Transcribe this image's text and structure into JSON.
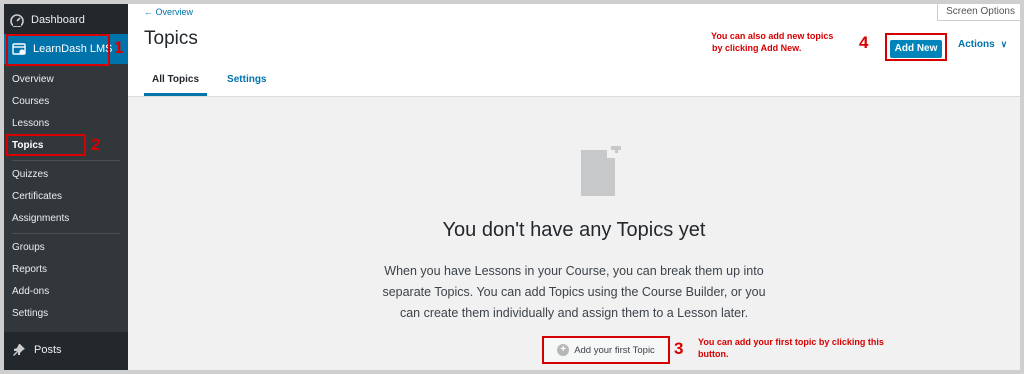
{
  "sidebar": {
    "dashboard_label": "Dashboard",
    "learndash_label": "LearnDash LMS",
    "items": [
      {
        "label": "Overview"
      },
      {
        "label": "Courses"
      },
      {
        "label": "Lessons"
      },
      {
        "label": "Topics"
      },
      {
        "label": "Quizzes"
      },
      {
        "label": "Certificates"
      },
      {
        "label": "Assignments"
      },
      {
        "label": "Groups"
      },
      {
        "label": "Reports"
      },
      {
        "label": "Add-ons"
      },
      {
        "label": "Settings"
      }
    ],
    "posts_label": "Posts"
  },
  "header": {
    "breadcrumb": "← Overview",
    "title": "Topics",
    "screen_options": "Screen Options",
    "add_new": "Add New",
    "actions": "Actions",
    "actions_chevron": "∨",
    "tabs": [
      {
        "label": "All Topics"
      },
      {
        "label": "Settings"
      }
    ]
  },
  "empty_state": {
    "heading": "You don't have any Topics yet",
    "body": "When you have Lessons in your Course, you can break them up into separate Topics. You can add Topics using the Course Builder, or you can create them individually and assign them to a Lesson later.",
    "button": "Add your first Topic",
    "button_icon": "+"
  },
  "annotations": {
    "n1": "1",
    "n2": "2",
    "n3": "3",
    "n4": "4",
    "note_add_new_line1": "You can also add new topics",
    "note_add_new_line2": "by clicking Add New.",
    "note_first_topic_line1": "You can add your first topic by clicking this",
    "note_first_topic_line2": "button."
  },
  "colors": {
    "sidebar_bg": "#23282d",
    "submenu_bg": "#32373c",
    "accent": "#0073aa",
    "button_blue": "#0085ba",
    "annotation_red": "#d60000"
  }
}
